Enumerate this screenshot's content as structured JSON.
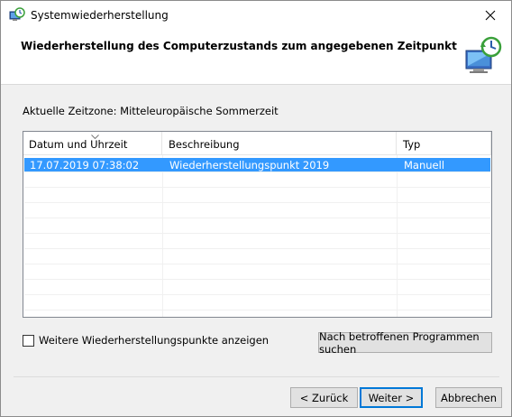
{
  "window": {
    "title": "Systemwiederherstellung",
    "close_glyph": "✕"
  },
  "header": {
    "title": "Wiederherstellung des Computerzustands zum angegebenen Zeitpunkt",
    "icon": "system-restore-icon"
  },
  "timezone_label": "Aktuelle Zeitzone: Mitteleuropäische Sommerzeit",
  "table": {
    "columns": [
      "Datum und Uhrzeit",
      "Beschreibung",
      "Typ"
    ],
    "rows": [
      [
        "17.07.2019 07:38:02",
        "Wiederherstellungspunkt 2019",
        "Manuell"
      ]
    ],
    "selected_row": 0,
    "sort_indicator": "v"
  },
  "more_points": {
    "label": "Weitere Wiederherstellungspunkte anzeigen",
    "checked": false
  },
  "buttons": {
    "scan": "Nach betroffenen Programmen suchen",
    "back": "< Zurück",
    "next": "Weiter >",
    "cancel": "Abbrechen"
  },
  "colors": {
    "selection": "#3399ff",
    "default_button_border": "#0078d7"
  }
}
